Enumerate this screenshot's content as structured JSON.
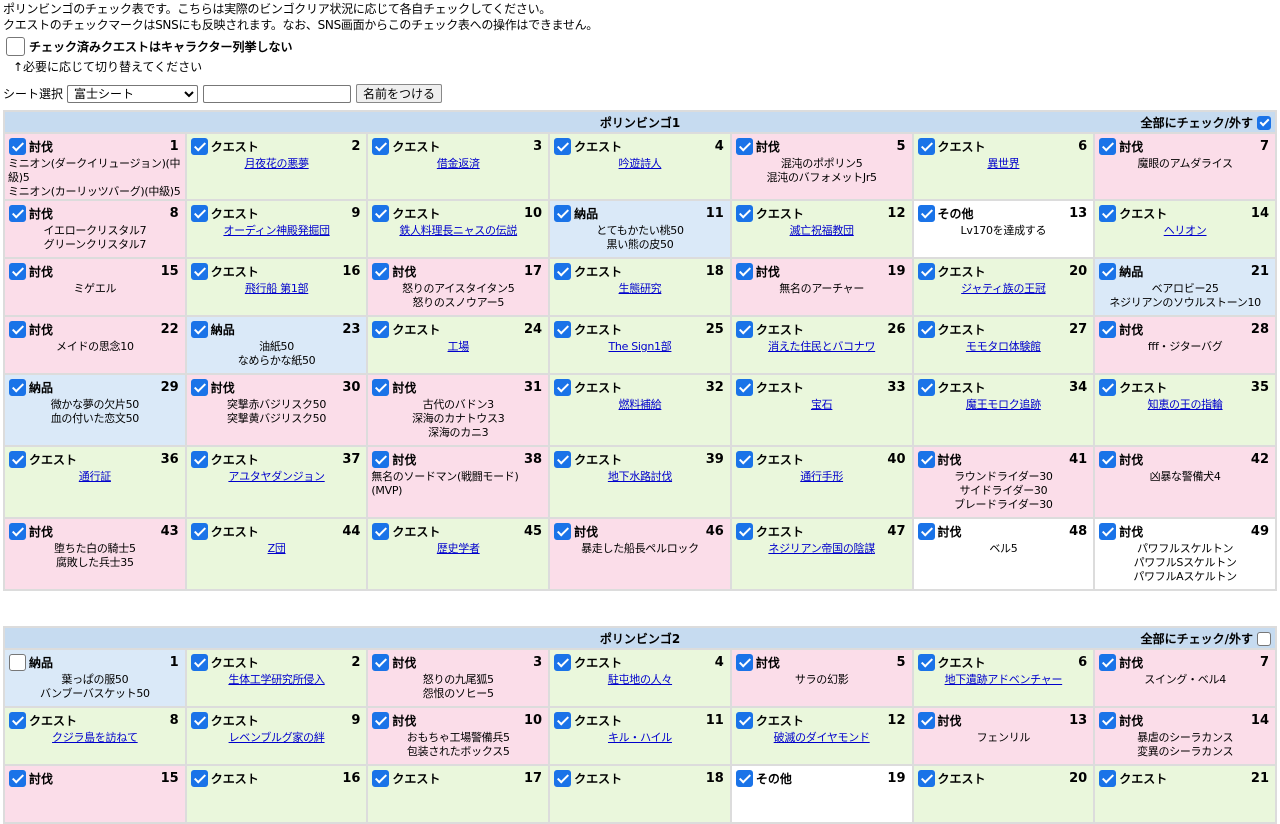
{
  "intro": {
    "line1": "ポリンビンゴのチェック表です。こちらは実際のビンゴクリア状況に応じて各自チェックしてください。",
    "line2": "クエストのチェックマークはSNSにも反映されます。なお、SNS画面からこのチェック表への操作はできません。"
  },
  "option": {
    "label": "チェック済みクエストはキャラクター列挙しない",
    "checked": false
  },
  "hint": "↑必要に応じて切り替えてください",
  "sheet": {
    "label": "シート選択",
    "selected": "富士シート",
    "name_value": "",
    "name_button": "名前をつける"
  },
  "check_all_label": "全部にチェック/外す",
  "boards": [
    {
      "title": "ポリンビンゴ1",
      "all_checked": true,
      "cells": [
        {
          "n": "1",
          "cat": "討伐",
          "type": "hunt",
          "checked": true,
          "lines": [
            "ミニオン(ダークイリュージョン)(中級)5",
            "ミニオン(カーリッツバーグ)(中級)5"
          ],
          "link": false,
          "align": "left"
        },
        {
          "n": "2",
          "cat": "クエスト",
          "type": "quest",
          "checked": true,
          "lines": [
            "月夜花の悪夢"
          ],
          "link": true
        },
        {
          "n": "3",
          "cat": "クエスト",
          "type": "quest",
          "checked": true,
          "lines": [
            "借金返済"
          ],
          "link": true
        },
        {
          "n": "4",
          "cat": "クエスト",
          "type": "quest",
          "checked": true,
          "lines": [
            "吟遊詩人"
          ],
          "link": true
        },
        {
          "n": "5",
          "cat": "討伐",
          "type": "hunt",
          "checked": true,
          "lines": [
            "混沌のポポリン5",
            "混沌のバフォメットJr5"
          ],
          "link": false
        },
        {
          "n": "6",
          "cat": "クエスト",
          "type": "quest",
          "checked": true,
          "lines": [
            "異世界"
          ],
          "link": true
        },
        {
          "n": "7",
          "cat": "討伐",
          "type": "hunt",
          "checked": true,
          "lines": [
            "魔眼のアムダライス"
          ],
          "link": false
        },
        {
          "n": "8",
          "cat": "討伐",
          "type": "hunt",
          "checked": true,
          "lines": [
            "イエロークリスタル7",
            "グリーンクリスタル7"
          ],
          "link": false
        },
        {
          "n": "9",
          "cat": "クエスト",
          "type": "quest",
          "checked": true,
          "lines": [
            "オーディン神殿発掘団"
          ],
          "link": true
        },
        {
          "n": "10",
          "cat": "クエスト",
          "type": "quest",
          "checked": true,
          "lines": [
            "鉄人料理長ニャスの伝説"
          ],
          "link": true
        },
        {
          "n": "11",
          "cat": "納品",
          "type": "deliv",
          "checked": true,
          "lines": [
            "とてもかたい桃50",
            "黒い熊の皮50"
          ],
          "link": false
        },
        {
          "n": "12",
          "cat": "クエスト",
          "type": "quest",
          "checked": true,
          "lines": [
            "滅亡祝福教団"
          ],
          "link": true
        },
        {
          "n": "13",
          "cat": "その他",
          "type": "other",
          "checked": true,
          "lines": [
            "Lv170を達成する"
          ],
          "link": false
        },
        {
          "n": "14",
          "cat": "クエスト",
          "type": "quest",
          "checked": true,
          "lines": [
            "ヘリオン"
          ],
          "link": true
        },
        {
          "n": "15",
          "cat": "討伐",
          "type": "hunt",
          "checked": true,
          "lines": [
            "ミゲエル"
          ],
          "link": false
        },
        {
          "n": "16",
          "cat": "クエスト",
          "type": "quest",
          "checked": true,
          "lines": [
            "飛行船 第1部"
          ],
          "link": true
        },
        {
          "n": "17",
          "cat": "討伐",
          "type": "hunt",
          "checked": true,
          "lines": [
            "怒りのアイスタイタン5",
            "怒りのスノウアー5"
          ],
          "link": false
        },
        {
          "n": "18",
          "cat": "クエスト",
          "type": "quest",
          "checked": true,
          "lines": [
            "生態研究"
          ],
          "link": true
        },
        {
          "n": "19",
          "cat": "討伐",
          "type": "hunt",
          "checked": true,
          "lines": [
            "無名のアーチャー"
          ],
          "link": false
        },
        {
          "n": "20",
          "cat": "クエスト",
          "type": "quest",
          "checked": true,
          "lines": [
            "ジャティ族の王冠"
          ],
          "link": true
        },
        {
          "n": "21",
          "cat": "納品",
          "type": "deliv",
          "checked": true,
          "lines": [
            "ベアロビー25",
            "ネジリアンのソウルストーン10"
          ],
          "link": false
        },
        {
          "n": "22",
          "cat": "討伐",
          "type": "hunt",
          "checked": true,
          "lines": [
            "メイドの思念10"
          ],
          "link": false
        },
        {
          "n": "23",
          "cat": "納品",
          "type": "deliv",
          "checked": true,
          "lines": [
            "油紙50",
            "なめらかな紙50"
          ],
          "link": false
        },
        {
          "n": "24",
          "cat": "クエスト",
          "type": "quest",
          "checked": true,
          "lines": [
            "工場"
          ],
          "link": true
        },
        {
          "n": "25",
          "cat": "クエスト",
          "type": "quest",
          "checked": true,
          "lines": [
            "The Sign1部"
          ],
          "link": true
        },
        {
          "n": "26",
          "cat": "クエスト",
          "type": "quest",
          "checked": true,
          "lines": [
            "消えた住民とバコナワ"
          ],
          "link": true
        },
        {
          "n": "27",
          "cat": "クエスト",
          "type": "quest",
          "checked": true,
          "lines": [
            "モモタロ体験館"
          ],
          "link": true
        },
        {
          "n": "28",
          "cat": "討伐",
          "type": "hunt",
          "checked": true,
          "lines": [
            "fff・ジターバグ"
          ],
          "link": false
        },
        {
          "n": "29",
          "cat": "納品",
          "type": "deliv",
          "checked": true,
          "lines": [
            "微かな夢の欠片50",
            "血の付いた恋文50"
          ],
          "link": false
        },
        {
          "n": "30",
          "cat": "討伐",
          "type": "hunt",
          "checked": true,
          "lines": [
            "突撃赤バジリスク50",
            "突撃黄バジリスク50"
          ],
          "link": false
        },
        {
          "n": "31",
          "cat": "討伐",
          "type": "hunt",
          "checked": true,
          "lines": [
            "古代のバドン3",
            "深海のカナトウス3",
            "深海のカニ3"
          ],
          "link": false
        },
        {
          "n": "32",
          "cat": "クエスト",
          "type": "quest",
          "checked": true,
          "lines": [
            "燃料補給"
          ],
          "link": true
        },
        {
          "n": "33",
          "cat": "クエスト",
          "type": "quest",
          "checked": true,
          "lines": [
            "宝石"
          ],
          "link": true
        },
        {
          "n": "34",
          "cat": "クエスト",
          "type": "quest",
          "checked": true,
          "lines": [
            "魔王モロク追跡"
          ],
          "link": true
        },
        {
          "n": "35",
          "cat": "クエスト",
          "type": "quest",
          "checked": true,
          "lines": [
            "知恵の王の指輪"
          ],
          "link": true
        },
        {
          "n": "36",
          "cat": "クエスト",
          "type": "quest",
          "checked": true,
          "lines": [
            "通行証"
          ],
          "link": true
        },
        {
          "n": "37",
          "cat": "クエスト",
          "type": "quest",
          "checked": true,
          "lines": [
            "アユタヤダンジョン"
          ],
          "link": true
        },
        {
          "n": "38",
          "cat": "討伐",
          "type": "hunt",
          "checked": true,
          "lines": [
            "無名のソードマン(戦闘モード)(MVP)"
          ],
          "link": false,
          "align": "left"
        },
        {
          "n": "39",
          "cat": "クエスト",
          "type": "quest",
          "checked": true,
          "lines": [
            "地下水路討伐"
          ],
          "link": true
        },
        {
          "n": "40",
          "cat": "クエスト",
          "type": "quest",
          "checked": true,
          "lines": [
            "通行手形"
          ],
          "link": true
        },
        {
          "n": "41",
          "cat": "討伐",
          "type": "hunt",
          "checked": true,
          "lines": [
            "ラウンドライダー30",
            "サイドライダー30",
            "ブレードライダー30"
          ],
          "link": false
        },
        {
          "n": "42",
          "cat": "討伐",
          "type": "hunt",
          "checked": true,
          "lines": [
            "凶暴な警備犬4"
          ],
          "link": false
        },
        {
          "n": "43",
          "cat": "討伐",
          "type": "hunt",
          "checked": true,
          "lines": [
            "堕ちた白の騎士5",
            "腐敗した兵士35"
          ],
          "link": false
        },
        {
          "n": "44",
          "cat": "クエスト",
          "type": "quest",
          "checked": true,
          "lines": [
            "Z団"
          ],
          "link": true
        },
        {
          "n": "45",
          "cat": "クエスト",
          "type": "quest",
          "checked": true,
          "lines": [
            "歴史学者"
          ],
          "link": true
        },
        {
          "n": "46",
          "cat": "討伐",
          "type": "hunt",
          "checked": true,
          "lines": [
            "暴走した船長ペルロック"
          ],
          "link": false
        },
        {
          "n": "47",
          "cat": "クエスト",
          "type": "quest",
          "checked": true,
          "lines": [
            "ネジリアン帝国の陰謀"
          ],
          "link": true
        },
        {
          "n": "48",
          "cat": "討伐",
          "type": "other",
          "checked": true,
          "lines": [
            "ベル5"
          ],
          "link": false
        },
        {
          "n": "49",
          "cat": "討伐",
          "type": "other",
          "checked": true,
          "lines": [
            "パワフルスケルトン",
            "パワフルSスケルトン",
            "パワフルAスケルトン"
          ],
          "link": false
        }
      ]
    },
    {
      "title": "ポリンビンゴ2",
      "all_checked": false,
      "cells": [
        {
          "n": "1",
          "cat": "納品",
          "type": "deliv",
          "checked": false,
          "lines": [
            "葉っぱの服50",
            "バンブーバスケット50"
          ],
          "link": false
        },
        {
          "n": "2",
          "cat": "クエスト",
          "type": "quest",
          "checked": true,
          "lines": [
            "生体工学研究所侵入"
          ],
          "link": true
        },
        {
          "n": "3",
          "cat": "討伐",
          "type": "hunt",
          "checked": true,
          "lines": [
            "怒りの九尾狐5",
            "怨恨のソヒー5"
          ],
          "link": false
        },
        {
          "n": "4",
          "cat": "クエスト",
          "type": "quest",
          "checked": true,
          "lines": [
            "駐屯地の人々"
          ],
          "link": true
        },
        {
          "n": "5",
          "cat": "討伐",
          "type": "hunt",
          "checked": true,
          "lines": [
            "サラの幻影"
          ],
          "link": false
        },
        {
          "n": "6",
          "cat": "クエスト",
          "type": "quest",
          "checked": true,
          "lines": [
            "地下遺跡アドベンチャー"
          ],
          "link": true
        },
        {
          "n": "7",
          "cat": "討伐",
          "type": "hunt",
          "checked": true,
          "lines": [
            "スイング・ベル4"
          ],
          "link": false
        },
        {
          "n": "8",
          "cat": "クエスト",
          "type": "quest",
          "checked": true,
          "lines": [
            "クジラ島を訪ねて"
          ],
          "link": true
        },
        {
          "n": "9",
          "cat": "クエスト",
          "type": "quest",
          "checked": true,
          "lines": [
            "レベンブルグ家の絆"
          ],
          "link": true
        },
        {
          "n": "10",
          "cat": "討伐",
          "type": "hunt",
          "checked": true,
          "lines": [
            "おもちゃ工場警備兵5",
            "包装されたボックス5"
          ],
          "link": false
        },
        {
          "n": "11",
          "cat": "クエスト",
          "type": "quest",
          "checked": true,
          "lines": [
            "キル・ハイル"
          ],
          "link": true
        },
        {
          "n": "12",
          "cat": "クエスト",
          "type": "quest",
          "checked": true,
          "lines": [
            "破滅のダイヤモンド"
          ],
          "link": true
        },
        {
          "n": "13",
          "cat": "討伐",
          "type": "hunt",
          "checked": true,
          "lines": [
            "フェンリル"
          ],
          "link": false
        },
        {
          "n": "14",
          "cat": "討伐",
          "type": "hunt",
          "checked": true,
          "lines": [
            "暴虐のシーラカンス",
            "変異のシーラカンス"
          ],
          "link": false
        },
        {
          "n": "15",
          "cat": "討伐",
          "type": "hunt",
          "checked": true,
          "lines": [],
          "link": false
        },
        {
          "n": "16",
          "cat": "クエスト",
          "type": "quest",
          "checked": true,
          "lines": [],
          "link": true
        },
        {
          "n": "17",
          "cat": "クエスト",
          "type": "quest",
          "checked": true,
          "lines": [],
          "link": true
        },
        {
          "n": "18",
          "cat": "クエスト",
          "type": "quest",
          "checked": true,
          "lines": [],
          "link": true
        },
        {
          "n": "19",
          "cat": "その他",
          "type": "other",
          "checked": true,
          "lines": [],
          "link": false
        },
        {
          "n": "20",
          "cat": "クエスト",
          "type": "quest",
          "checked": true,
          "lines": [],
          "link": true
        },
        {
          "n": "21",
          "cat": "クエスト",
          "type": "quest",
          "checked": true,
          "lines": [],
          "link": true
        }
      ]
    }
  ]
}
